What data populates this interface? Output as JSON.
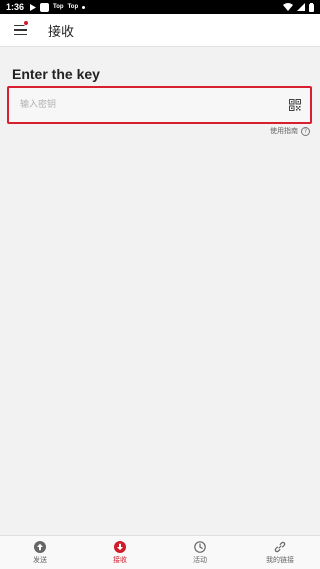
{
  "status_bar": {
    "time": "1:36",
    "app_label_1": "Top",
    "app_label_2": "Top"
  },
  "app_bar": {
    "title": "接收",
    "menu_icon": "menu-icon",
    "badge_color": "#d01c2a"
  },
  "main": {
    "heading": "Enter the key",
    "key_input": {
      "value": "",
      "placeholder": "输入密钥"
    },
    "scan_icon": "qr-code-icon",
    "guide_label": "使用指南",
    "accent_color": "#d81f2e"
  },
  "bottom_nav": {
    "items": [
      {
        "label": "发送",
        "icon": "arrow-up-icon",
        "active": false
      },
      {
        "label": "接收",
        "icon": "arrow-down-icon",
        "active": true
      },
      {
        "label": "活动",
        "icon": "clock-icon",
        "active": false
      },
      {
        "label": "我的链接",
        "icon": "link-icon",
        "active": false
      }
    ]
  }
}
